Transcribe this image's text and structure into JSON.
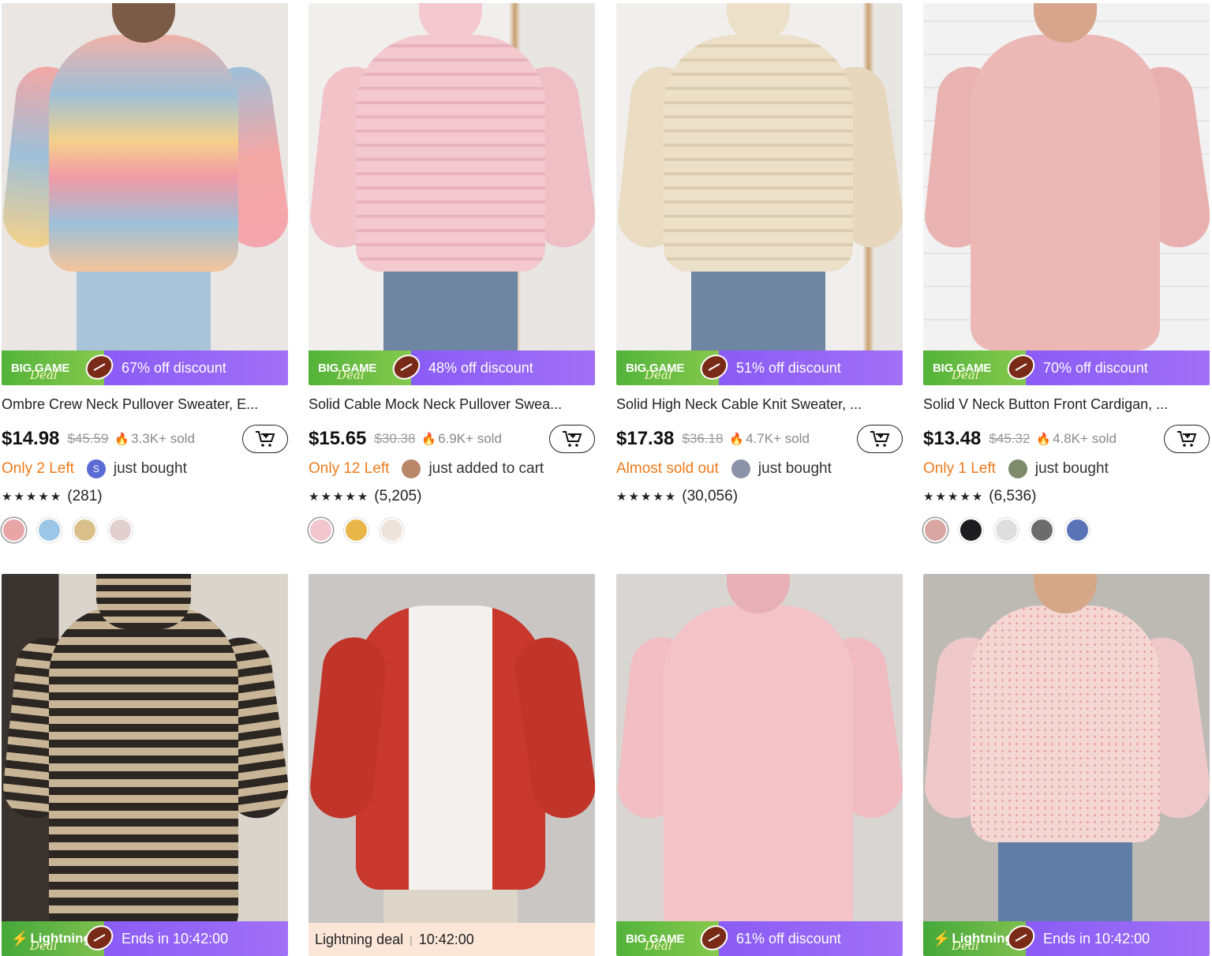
{
  "products_row1": [
    {
      "badge_text": "67% off discount",
      "title": "Ombre Crew Neck Pullover Sweater, E...",
      "price": "$14.98",
      "old_price": "$45.59",
      "sold": "3.3K+ sold",
      "stock": "Only 2 Left",
      "activity": "just bought",
      "avatar_letter": "S",
      "rating_count": "(281)",
      "swatches": [
        "#e8a5a6",
        "#9cc6e6",
        "#d9c08a",
        "#e2cfd0"
      ]
    },
    {
      "badge_text": "48% off discount",
      "title": "Solid Cable Mock Neck Pullover Swea...",
      "price": "$15.65",
      "old_price": "$30.38",
      "sold": "6.9K+ sold",
      "stock": "Only 12 Left",
      "activity": "just added to cart",
      "avatar_letter": "",
      "rating_count": "(5,205)",
      "swatches": [
        "#f1c6cf",
        "#e9b64a",
        "#eee3da"
      ]
    },
    {
      "badge_text": "51% off discount",
      "title": "Solid High Neck Cable Knit Sweater, ...",
      "price": "$17.38",
      "old_price": "$36.18",
      "sold": "4.7K+ sold",
      "stock": "Almost sold out",
      "activity": "just bought",
      "avatar_letter": "",
      "rating_count": "(30,056)",
      "swatches": []
    },
    {
      "badge_text": "70% off discount",
      "title": "Solid V Neck Button Front Cardigan, ...",
      "price": "$13.48",
      "old_price": "$45.32",
      "sold": "4.8K+ sold",
      "stock": "Only 1 Left",
      "activity": "just bought",
      "avatar_letter": "",
      "rating_count": "(6,536)",
      "swatches": [
        "#d9a6a4",
        "#1d1d1f",
        "#dedede",
        "#6c6c6c",
        "#5a72b6"
      ]
    }
  ],
  "row2": {
    "lightning_label": "Lightning",
    "deal_script": "Deal",
    "big_game": "BIG GAME",
    "ends_1": "Ends in 10:42:00",
    "plain_deal_label": "Lightning deal",
    "plain_deal_time": "10:42:00",
    "discount_3": "61% off discount",
    "ends_4": "Ends in 10:42:00"
  },
  "labels": {
    "big_game": "BIG GAME",
    "deal": "Deal",
    "stars": "★★★★★"
  },
  "colors": {
    "accent_orange": "#f07a1a",
    "badge_purple": "#8a5cf6",
    "badge_green": "#53b33a"
  }
}
